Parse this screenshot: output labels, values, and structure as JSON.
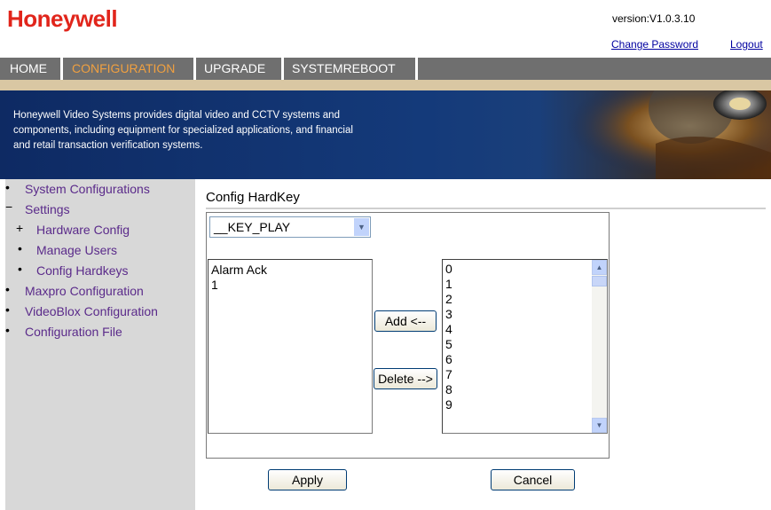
{
  "header": {
    "logo": "Honeywell",
    "version": "version:V1.0.3.10",
    "change_password": "Change Password",
    "logout": "Logout"
  },
  "nav": {
    "items": [
      {
        "label": "HOME"
      },
      {
        "label": "CONFIGURATION"
      },
      {
        "label": "UPGRADE"
      },
      {
        "label": "SYSTEMREBOOT"
      }
    ],
    "active_color": "#f0a040"
  },
  "banner": {
    "line1": "Honeywell Video Systems provides digital video and CCTV systems and",
    "line2": "components, including equipment for specialized applications, and financial",
    "line3": "and retail transaction verification systems."
  },
  "sidebar": {
    "items": [
      {
        "bullet": "•",
        "label": "System Configurations"
      },
      {
        "bullet": "−",
        "label": "Settings"
      },
      {
        "bullet": "+",
        "label": "Hardware Config"
      },
      {
        "bullet": "•",
        "label": "Manage Users"
      },
      {
        "bullet": "•",
        "label": "Config Hardkeys"
      },
      {
        "bullet": "•",
        "label": "Maxpro Configuration"
      },
      {
        "bullet": "•",
        "label": "VideoBlox Configuration"
      },
      {
        "bullet": "•",
        "label": "Configuration File"
      }
    ]
  },
  "main": {
    "title": "Config HardKey",
    "key_select": "__KEY_PLAY",
    "assigned": [
      "Alarm Ack",
      "1"
    ],
    "available": [
      "0",
      "1",
      "2",
      "3",
      "4",
      "5",
      "6",
      "7",
      "8",
      "9"
    ],
    "add_label": "Add <--",
    "delete_label": "Delete -->",
    "apply_label": "Apply",
    "cancel_label": "Cancel"
  },
  "icons": {
    "dropdown": "chevron-down-icon",
    "scroll_up": "scroll-up-icon",
    "scroll_down": "scroll-down-icon"
  }
}
